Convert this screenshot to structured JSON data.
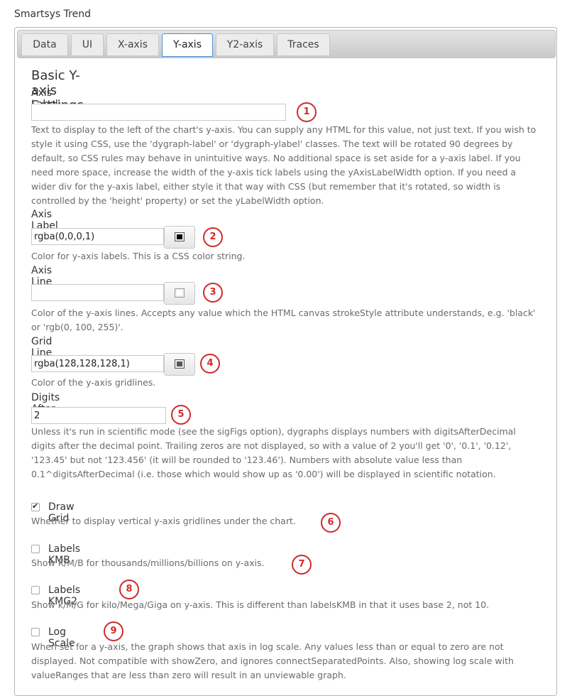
{
  "app": {
    "title": "Smartsys Trend"
  },
  "tabs": [
    {
      "label": "Data",
      "active": false
    },
    {
      "label": "UI",
      "active": false
    },
    {
      "label": "X-axis",
      "active": false
    },
    {
      "label": "Y-axis",
      "active": true
    },
    {
      "label": "Y2-axis",
      "active": false
    },
    {
      "label": "Traces",
      "active": false
    }
  ],
  "section": {
    "title": "Basic Y-axis Settings"
  },
  "fields": {
    "axis_label": {
      "label": "Axis Label:",
      "value": "",
      "badge": "1",
      "description": "Text to display to the left of the chart's y-axis. You can supply any HTML for this value, not just text. If you wish to style it using CSS, use the 'dygraph-label' or 'dygraph-ylabel' classes. The text will be rotated 90 degrees by default, so CSS rules may behave in unintuitive ways. No additional space is set aside for a y-axis label. If you need more space, increase the width of the y-axis tick labels using the yAxisLabelWidth option. If you need a wider div for the y-axis label, either style it that way with CSS (but remember that it's rotated, so width is controlled by the 'height' property) or set the yLabelWidth option."
    },
    "axis_label_color": {
      "label": "Axis Label Color:",
      "value": "rgba(0,0,0,1)",
      "swatch": "#000000",
      "badge": "2",
      "description": "Color for y-axis labels. This is a CSS color string."
    },
    "axis_line_color": {
      "label": "Axis Line Color:",
      "value": "",
      "swatch": "#ffffff",
      "badge": "3",
      "description": "Color of the y-axis lines. Accepts any value which the HTML canvas strokeStyle attribute understands, e.g. 'black' or 'rgb(0, 100, 255)'."
    },
    "grid_line_color": {
      "label": "Grid Line Color:",
      "value": "rgba(128,128,128,1)",
      "swatch": "#808080",
      "badge": "4",
      "description": "Color of the y-axis gridlines."
    },
    "digits_after_decimal": {
      "label": "Digits After Decimal:",
      "value": "2",
      "badge": "5",
      "description": "Unless it's run in scientific mode (see the sigFigs option), dygraphs displays numbers with digitsAfterDecimal digits after the decimal point. Trailing zeros are not displayed, so with a value of 2 you'll get '0', '0.1', '0.12', '123.45' but not '123.456' (it will be rounded to '123.46'). Numbers with absolute value less than 0.1^digitsAfterDecimal (i.e. those which would show up as '0.00') will be displayed in scientific notation."
    },
    "draw_grid": {
      "label": "Draw Grid",
      "checked": true,
      "badge": "6",
      "description": "Whether to display vertical y-axis gridlines under the chart."
    },
    "labels_kmb": {
      "label": "Labels KMB",
      "checked": false,
      "badge": "7",
      "description": "Show K/M/B for thousands/millions/billions on y-axis."
    },
    "labels_kmg2": {
      "label": "Labels KMG2",
      "checked": false,
      "badge": "8",
      "description": "Show k/M/G for kilo/Mega/Giga on y-axis. This is different than labelsKMB in that it uses base 2, not 10."
    },
    "log_scale": {
      "label": "Log Scale",
      "checked": false,
      "badge": "9",
      "description": "When set for a y-axis, the graph shows that axis in log scale. Any values less than or equal to zero are not displayed. Not compatible with showZero, and ignores connectSeparatedPoints. Also, showing log scale with valueRanges that are less than zero will result in an unviewable graph."
    }
  },
  "colors": {
    "badge": "#d12a2a",
    "active_tab_border": "#4a90d9"
  }
}
